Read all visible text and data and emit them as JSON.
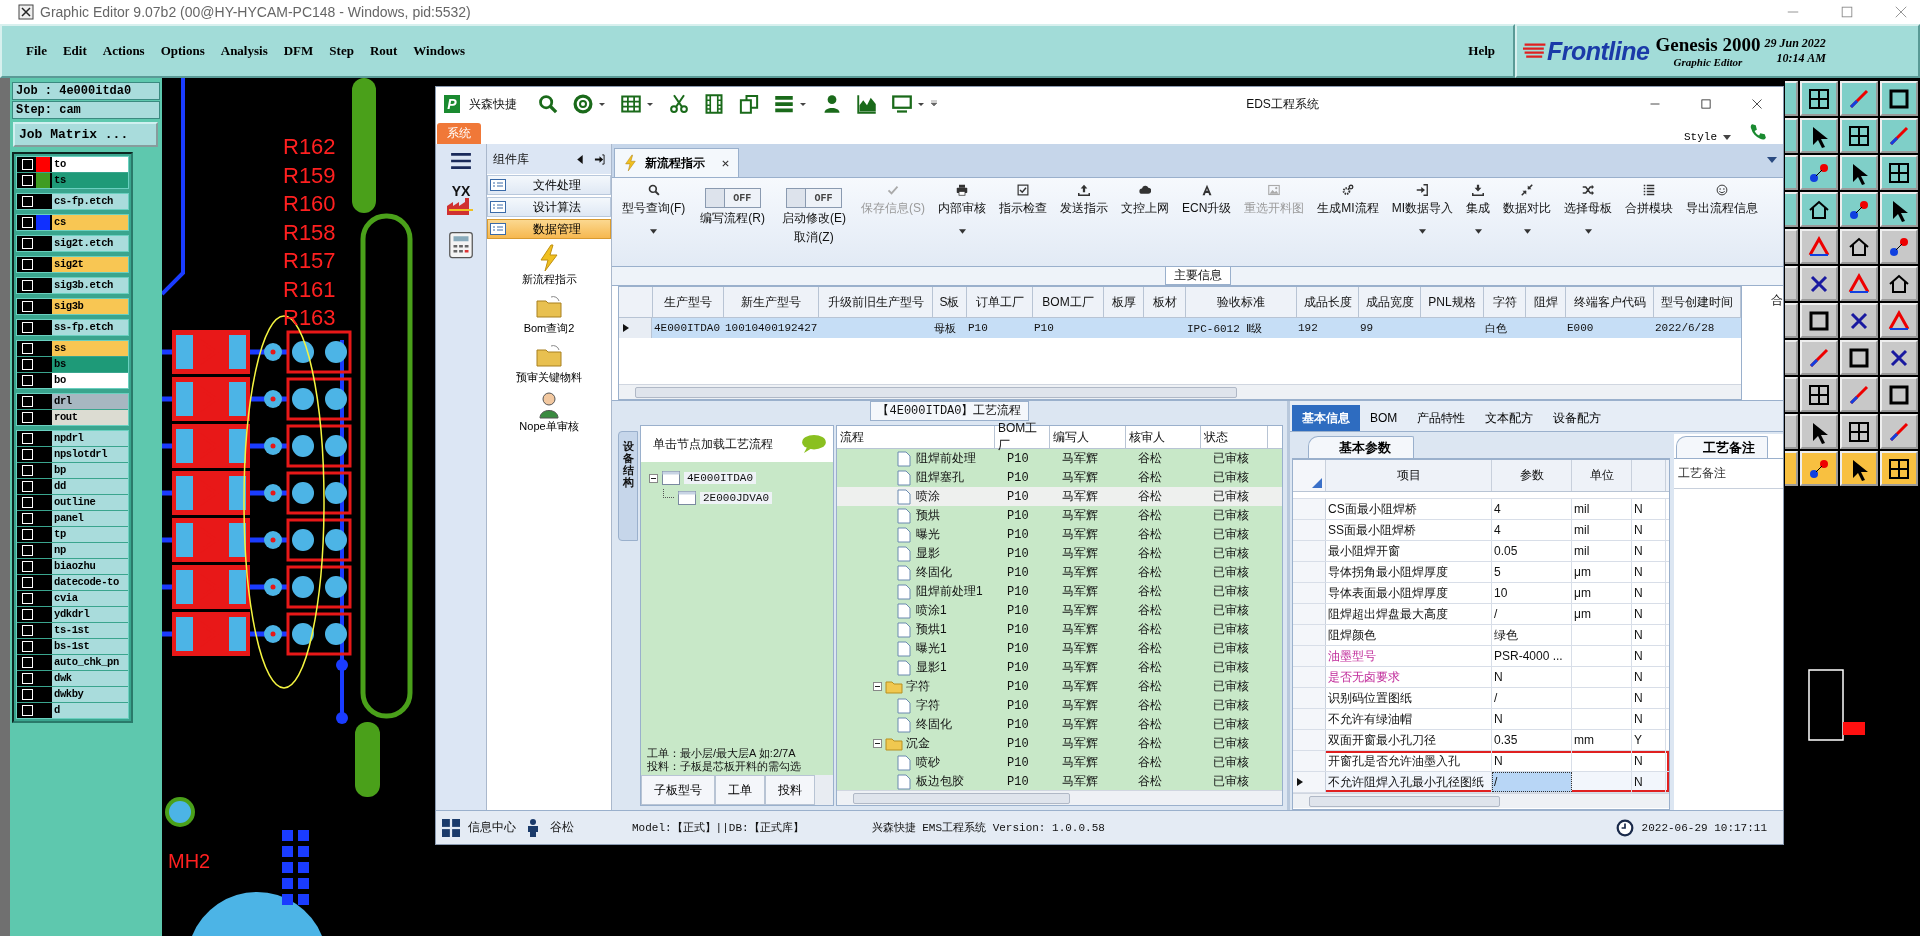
{
  "genesis": {
    "title": "Graphic Editor 9.07b2 (00@HY-HYCAM-PC148 - Windows, pid:5532)",
    "menu": [
      "File",
      "Edit",
      "Actions",
      "Options",
      "Analysis",
      "DFM",
      "Step",
      "Rout",
      "Windows"
    ],
    "help": "Help",
    "logo": "Frontline",
    "product": "Genesis 2000",
    "subtitle": "Graphic Editor",
    "date": "29 Jun 2022",
    "time": "10:14 AM",
    "job": "Job : 4e000itda0",
    "step": "Step: cam",
    "job_matrix": "Job Matrix ...",
    "layer_groups": [
      [
        {
          "name": "to",
          "kind": "silk",
          "color": "#ff0000",
          "checked": false
        },
        {
          "name": "ts",
          "kind": "mask",
          "color": "#3f9c22",
          "checked": false
        }
      ],
      [
        {
          "name": "cs-fp.etch",
          "kind": "doc",
          "checked": false
        }
      ],
      [
        {
          "name": "cs",
          "kind": "signal",
          "color": "#1030ff",
          "checked": false
        }
      ],
      [
        {
          "name": "sig2t.etch",
          "kind": "doc",
          "checked": false
        }
      ],
      [
        {
          "name": "sig2t",
          "kind": "signal",
          "checked": false
        }
      ],
      [
        {
          "name": "sig3b.etch",
          "kind": "doc",
          "checked": false
        }
      ],
      [
        {
          "name": "sig3b",
          "kind": "signal",
          "checked": false
        }
      ],
      [
        {
          "name": "ss-fp.etch",
          "kind": "doc",
          "checked": false
        }
      ],
      [
        {
          "name": "ss",
          "kind": "signal",
          "checked": false
        },
        {
          "name": "bs",
          "kind": "mask",
          "checked": false
        },
        {
          "name": "bo",
          "kind": "silk",
          "checked": false
        }
      ],
      [
        {
          "name": "drl",
          "kind": "drill",
          "checked": false
        },
        {
          "name": "rout",
          "kind": "rout",
          "checked": false
        }
      ],
      [
        {
          "name": "npdrl",
          "kind": "doc",
          "checked": false
        },
        {
          "name": "npslotdrl",
          "kind": "doc",
          "checked": false
        },
        {
          "name": "bp",
          "kind": "doc",
          "checked": false
        },
        {
          "name": "dd",
          "kind": "doc",
          "checked": false
        },
        {
          "name": "outline",
          "kind": "doc",
          "checked": false
        },
        {
          "name": "panel",
          "kind": "doc",
          "checked": false
        },
        {
          "name": "tp",
          "kind": "doc",
          "checked": false
        },
        {
          "name": "np",
          "kind": "doc",
          "checked": false
        },
        {
          "name": "biaozhu",
          "kind": "doc",
          "checked": false
        },
        {
          "name": "datecode-to",
          "kind": "doc",
          "checked": false
        },
        {
          "name": "cvia",
          "kind": "doc",
          "checked": false
        },
        {
          "name": "ydkdrl",
          "kind": "doc",
          "checked": false
        },
        {
          "name": "ts-1st",
          "kind": "doc",
          "checked": false
        },
        {
          "name": "bs-1st",
          "kind": "doc",
          "checked": false
        },
        {
          "name": "auto_chk_pn",
          "kind": "doc",
          "checked": false
        },
        {
          "name": "dwk",
          "kind": "doc",
          "checked": false
        },
        {
          "name": "dwkby",
          "kind": "doc",
          "checked": false
        },
        {
          "name": "d",
          "kind": "doc",
          "checked": false
        }
      ]
    ]
  },
  "canvas": {
    "labels": [
      "R162",
      "R159",
      "R160",
      "R158",
      "R157",
      "R161",
      "R163"
    ],
    "mark": "MH2"
  },
  "eds": {
    "logo_letter": "P",
    "brand": "兴森快捷",
    "title": "EDS工程系统",
    "system_tab": "系统",
    "style": "Style",
    "badge": "YX",
    "nav_panel": {
      "title": "组件库",
      "items": [
        {
          "label": "文件处理",
          "selected": false
        },
        {
          "label": "设计算法",
          "selected": false
        },
        {
          "label": "数据管理",
          "selected": true
        }
      ],
      "tools": [
        {
          "label": "新流程指示",
          "kind": "bolt"
        },
        {
          "label": "Bom查询2",
          "kind": "folder"
        },
        {
          "label": "预审关键物料",
          "kind": "folder"
        },
        {
          "label": "Nope单审核",
          "kind": "person"
        }
      ]
    },
    "doc_tab": "新流程指示",
    "ribbon": [
      {
        "label": "型号查询(F)",
        "kind": "button",
        "dropdown": true,
        "disabled": false
      },
      {
        "label": "编写流程(R)",
        "kind": "toggle",
        "toggle_text": "OFF",
        "on": false,
        "disabled": false
      },
      {
        "label": "启动修改(E)",
        "sublabel": "取消(Z)",
        "kind": "toggle",
        "toggle_text": "OFF",
        "on": false,
        "disabled": false
      },
      {
        "label": "保存信息(S)",
        "kind": "button",
        "dropdown": false,
        "disabled": true
      },
      {
        "label": "内部审核",
        "kind": "button",
        "dropdown": true,
        "disabled": false
      },
      {
        "label": "指示检查",
        "kind": "button",
        "dropdown": false,
        "disabled": false
      },
      {
        "label": "发送指示",
        "kind": "button",
        "dropdown": false,
        "disabled": false
      },
      {
        "label": "文控上网",
        "kind": "button",
        "dropdown": false,
        "disabled": false
      },
      {
        "label": "ECN升级",
        "kind": "button",
        "dropdown": false,
        "disabled": false
      },
      {
        "label": "重选开料图",
        "kind": "button",
        "dropdown": false,
        "disabled": true
      },
      {
        "label": "生成MI流程",
        "kind": "button",
        "dropdown": false,
        "disabled": false
      },
      {
        "label": "MI数据导入",
        "kind": "button",
        "dropdown": true,
        "disabled": false
      },
      {
        "label": "集成",
        "kind": "button",
        "dropdown": true,
        "disabled": false
      },
      {
        "label": "数据对比",
        "kind": "button",
        "dropdown": true,
        "disabled": false
      },
      {
        "label": "选择母板",
        "kind": "button",
        "dropdown": true,
        "disabled": false
      },
      {
        "label": "合拼模块",
        "kind": "button",
        "dropdown": false,
        "disabled": false
      },
      {
        "label": "导出流程信息",
        "kind": "button",
        "dropdown": false,
        "disabled": false
      }
    ],
    "main_info": {
      "title": "主要信息",
      "side_column": "合",
      "columns": [
        "生产型号",
        "新生产型号",
        "升级前旧生产型号",
        "S板",
        "订单工厂",
        "BOM工厂",
        "板厚",
        "板材",
        "验收标准",
        "成品长度",
        "成品宽度",
        "PNL规格",
        "字符",
        "阻焊",
        "终端客户代码",
        "型号创建时间"
      ],
      "rows": [
        {
          "selected": true,
          "cells": [
            "4E000ITDA0",
            "10010400192427",
            null,
            "母板",
            "P10",
            "P10",
            null,
            null,
            "IPC-6012 Ⅱ级",
            "192",
            "99",
            null,
            "白色",
            null,
            "E000",
            "2022/6/28"
          ]
        }
      ]
    },
    "flow": {
      "title": "【4E000ITDA0】工艺流程",
      "side_tab": "设备结构",
      "tree_hint": "单击节点加载工艺流程",
      "tree": [
        {
          "label": "4E000ITDA0",
          "expanded": true,
          "children": [
            {
              "label": "2E000JDVA0"
            }
          ]
        }
      ],
      "notes": [
        "工单：最小层/最大层A 如:2/7A",
        "投料：子板是芯板开料的需勾选"
      ],
      "bottom_tabs": [
        "子板型号",
        "工单",
        "投料"
      ],
      "columns": [
        "流程",
        "BOM工厂",
        "编写人",
        "核审人",
        "状态"
      ],
      "rows": [
        {
          "kind": "step",
          "name": "阻焊前处理",
          "factory": "P10",
          "writer": "马军辉",
          "reviewer": "谷松",
          "status": "已审核",
          "selected": false
        },
        {
          "kind": "step",
          "name": "阻焊塞孔",
          "factory": "P10",
          "writer": "马军辉",
          "reviewer": "谷松",
          "status": "已审核",
          "selected": false
        },
        {
          "kind": "step",
          "name": "喷涂",
          "factory": "P10",
          "writer": "马军辉",
          "reviewer": "谷松",
          "status": "已审核",
          "selected": true
        },
        {
          "kind": "step",
          "name": "预烘",
          "factory": "P10",
          "writer": "马军辉",
          "reviewer": "谷松",
          "status": "已审核",
          "selected": false
        },
        {
          "kind": "step",
          "name": "曝光",
          "factory": "P10",
          "writer": "马军辉",
          "reviewer": "谷松",
          "status": "已审核",
          "selected": false
        },
        {
          "kind": "step",
          "name": "显影",
          "factory": "P10",
          "writer": "马军辉",
          "reviewer": "谷松",
          "status": "已审核",
          "selected": false
        },
        {
          "kind": "step",
          "name": "终固化",
          "factory": "P10",
          "writer": "马军辉",
          "reviewer": "谷松",
          "status": "已审核",
          "selected": false
        },
        {
          "kind": "step",
          "name": "阻焊前处理1",
          "factory": "P10",
          "writer": "马军辉",
          "reviewer": "谷松",
          "status": "已审核",
          "selected": false
        },
        {
          "kind": "step",
          "name": "喷涂1",
          "factory": "P10",
          "writer": "马军辉",
          "reviewer": "谷松",
          "status": "已审核",
          "selected": false
        },
        {
          "kind": "step",
          "name": "预烘1",
          "factory": "P10",
          "writer": "马军辉",
          "reviewer": "谷松",
          "status": "已审核",
          "selected": false
        },
        {
          "kind": "step",
          "name": "曝光1",
          "factory": "P10",
          "writer": "马军辉",
          "reviewer": "谷松",
          "status": "已审核",
          "selected": false
        },
        {
          "kind": "step",
          "name": "显影1",
          "factory": "P10",
          "writer": "马军辉",
          "reviewer": "谷松",
          "status": "已审核",
          "selected": false
        },
        {
          "kind": "folder",
          "name": "字符",
          "factory": "P10",
          "writer": "马军辉",
          "reviewer": "谷松",
          "status": "已审核",
          "selected": false,
          "expanded": true,
          "children": [
            {
              "kind": "step",
              "name": "字符",
              "factory": "P10",
              "writer": "马军辉",
              "reviewer": "谷松",
              "status": "已审核",
              "selected": false
            },
            {
              "kind": "step",
              "name": "终固化",
              "factory": "P10",
              "writer": "马军辉",
              "reviewer": "谷松",
              "status": "已审核",
              "selected": false
            }
          ]
        },
        {
          "kind": "folder",
          "name": "沉金",
          "factory": "P10",
          "writer": "马军辉",
          "reviewer": "谷松",
          "status": "已审核",
          "selected": false,
          "expanded": true,
          "children": [
            {
              "kind": "step",
              "name": "喷砂",
              "factory": "P10",
              "writer": "马军辉",
              "reviewer": "谷松",
              "status": "已审核",
              "selected": false
            },
            {
              "kind": "step",
              "name": "板边包胶",
              "factory": "P10",
              "writer": "马军辉",
              "reviewer": "谷松",
              "status": "已审核",
              "selected": false
            }
          ]
        }
      ]
    },
    "detail_tabs": [
      {
        "label": "基本信息",
        "selected": true
      },
      {
        "label": "BOM",
        "selected": false
      },
      {
        "label": "产品特性",
        "selected": false
      },
      {
        "label": "文本配方",
        "selected": false
      },
      {
        "label": "设备配方",
        "selected": false
      }
    ],
    "params": {
      "tab": "基本参数",
      "columns": [
        "项目",
        "参数",
        "单位"
      ],
      "rows": [
        {
          "item": "CS面最小阻焊桥",
          "value": "4",
          "unit": "mil",
          "flag": "N",
          "flagged": false,
          "selected": false,
          "boxed": false
        },
        {
          "item": "SS面最小阻焊桥",
          "value": "4",
          "unit": "mil",
          "flag": "N",
          "flagged": false,
          "selected": false,
          "boxed": false
        },
        {
          "item": "最小阻焊开窗",
          "value": "0.05",
          "unit": "mil",
          "flag": "N",
          "flagged": false,
          "selected": false,
          "boxed": false
        },
        {
          "item": "导体拐角最小阻焊厚度",
          "value": "5",
          "unit": "μm",
          "flag": "N",
          "flagged": false,
          "selected": false,
          "boxed": false
        },
        {
          "item": "导体表面最小阻焊厚度",
          "value": "10",
          "unit": "μm",
          "flag": "N",
          "flagged": false,
          "selected": false,
          "boxed": false
        },
        {
          "item": "阻焊超出焊盘最大高度",
          "value": "/",
          "unit": "μm",
          "flag": "N",
          "flagged": false,
          "selected": false,
          "boxed": false
        },
        {
          "item": "阻焊颜色",
          "value": "绿色",
          "flag": "N",
          "flagged": false,
          "selected": false,
          "boxed": false
        },
        {
          "item": "油墨型号",
          "value": "PSR-4000 ...",
          "flag": "N",
          "flagged": true,
          "selected": false,
          "boxed": false
        },
        {
          "item": "是否无卤要求",
          "value": "N",
          "flag": "N",
          "flagged": true,
          "selected": false,
          "boxed": false
        },
        {
          "item": "识别码位置图纸",
          "value": "/",
          "flag": "N",
          "flagged": false,
          "selected": false,
          "boxed": false
        },
        {
          "item": "不允许有绿油帽",
          "value": "N",
          "flag": "N",
          "flagged": false,
          "selected": false,
          "boxed": false
        },
        {
          "item": "双面开窗最小孔刀径",
          "value": "0.35",
          "unit": "mm",
          "flag": "Y",
          "flagged": false,
          "selected": false,
          "boxed": false
        },
        {
          "item": "开窗孔是否允许油墨入孔",
          "value": "N",
          "flag": "N",
          "flagged": false,
          "selected": false,
          "boxed": true
        },
        {
          "item": "不允许阻焊入孔最小孔径图纸",
          "value": "/",
          "flag": "N",
          "flagged": false,
          "selected": true,
          "boxed": true
        }
      ]
    },
    "notes_panel": {
      "tab": "工艺备注",
      "label": "工艺备注"
    },
    "status": {
      "info": "信息中心",
      "user": "谷松",
      "model": "Model:【正式】||DB:【正式库】",
      "version": "兴森快捷 EMS工程系统 Version: 1.0.0.58",
      "time": "2022-06-29 10:17:11"
    }
  }
}
